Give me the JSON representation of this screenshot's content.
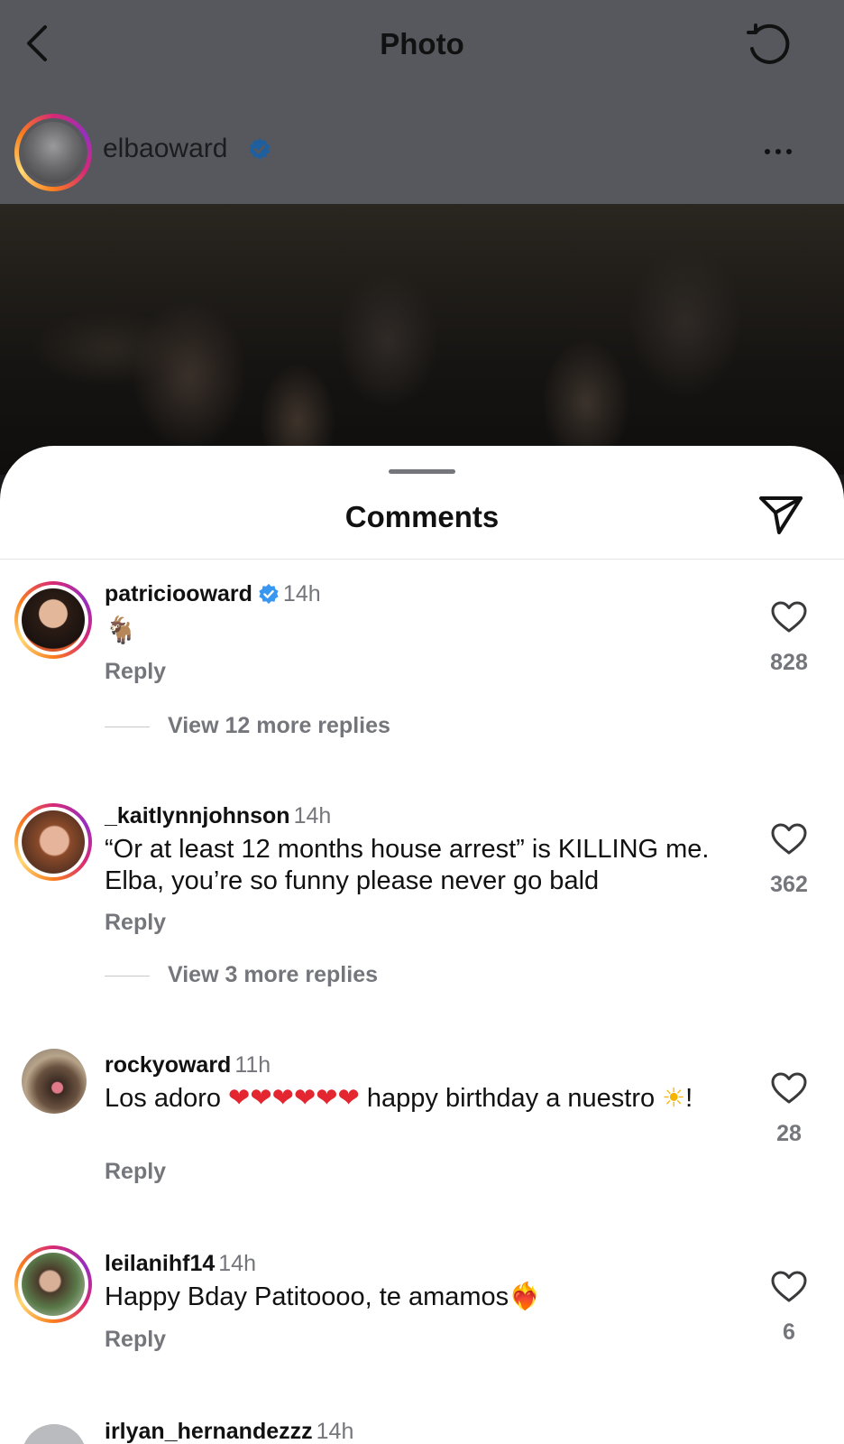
{
  "header": {
    "title": "Photo",
    "icons": {
      "back": "chevron-left-icon",
      "refresh": "refresh-icon"
    }
  },
  "post": {
    "author": "elbaoward",
    "author_verified": true,
    "more_icon": "more-dots-icon"
  },
  "comments_sheet": {
    "title": "Comments",
    "share_icon": "send-icon",
    "comments": [
      {
        "user": "patriciooward",
        "verified": true,
        "time": "14h",
        "text": "🐐",
        "reply": "Reply",
        "likes": "828",
        "view_replies": "View 12 more replies"
      },
      {
        "user": "_kaitlynnjohnson",
        "verified": false,
        "time": "14h",
        "text": "“Or at least 12 months house arrest” is KILLING me. Elba, you’re so funny please never go bald",
        "reply": "Reply",
        "likes": "362",
        "view_replies": "View 3 more replies"
      },
      {
        "user": "rockyoward",
        "verified": false,
        "time": "11h",
        "text_before": "Los adoro ",
        "hearts": "❤❤❤❤❤❤",
        "text_after": " happy birthday a nuestro ",
        "emoji": "☀",
        "text_end": "!",
        "reply": "Reply",
        "likes": "28"
      },
      {
        "user": "leilanihf14",
        "verified": false,
        "time": "14h",
        "text": "Happy Bday Patitoooo, te amamos",
        "emoji": "❤‍🔥",
        "reply": "Reply",
        "likes": "6"
      },
      {
        "user": "irlyan_hernandezzz",
        "time": "14h"
      }
    ]
  },
  "colors": {
    "accent_verified": "#3897f0",
    "secondary_text": "#75767b",
    "dim_header": "#57585d"
  }
}
